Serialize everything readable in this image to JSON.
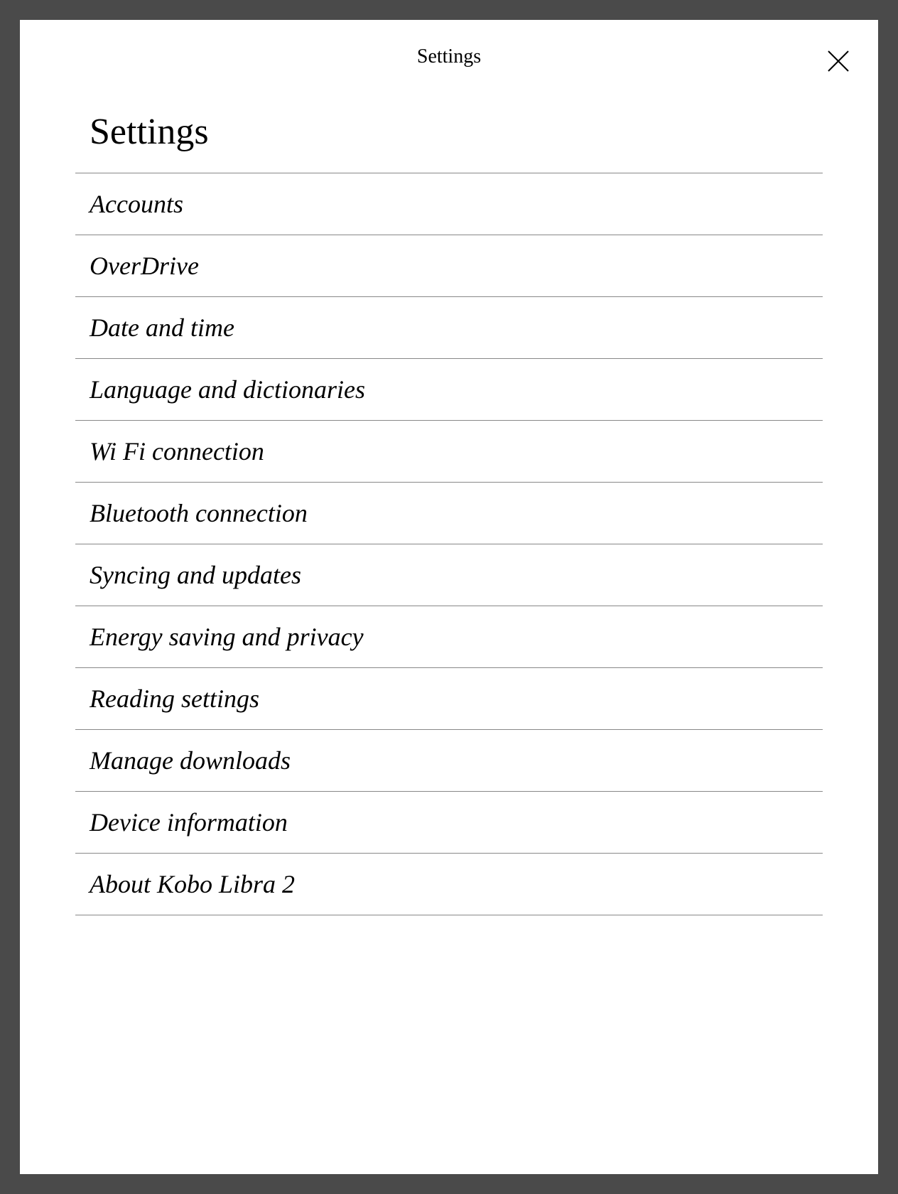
{
  "header": {
    "title": "Settings"
  },
  "page": {
    "title": "Settings"
  },
  "menu": {
    "items": [
      {
        "label": "Accounts"
      },
      {
        "label": "OverDrive"
      },
      {
        "label": "Date and time"
      },
      {
        "label": "Language and dictionaries"
      },
      {
        "label": "Wi Fi connection"
      },
      {
        "label": "Bluetooth connection"
      },
      {
        "label": "Syncing and updates"
      },
      {
        "label": "Energy saving and privacy"
      },
      {
        "label": "Reading settings"
      },
      {
        "label": "Manage downloads"
      },
      {
        "label": "Device information"
      },
      {
        "label": "About Kobo Libra 2"
      }
    ]
  }
}
